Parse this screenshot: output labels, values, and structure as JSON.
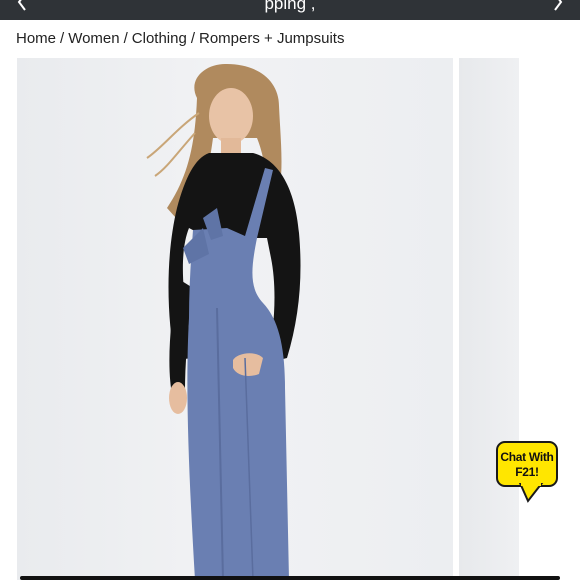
{
  "topbar": {
    "promo_text": "pping       ,"
  },
  "breadcrumb": {
    "items": [
      "Home",
      "Women",
      "Clothing",
      "Rompers + Jumpsuits"
    ],
    "separator": "/"
  },
  "product_gallery": {
    "main_image_alt": "Model wearing blue corduroy overalls",
    "colors": {
      "overalls": "#6a7fb2",
      "top": "#121212",
      "background": "#eceef1"
    }
  },
  "chat": {
    "line1": "Chat With",
    "line2": "F21!",
    "color": "#ffe600"
  }
}
